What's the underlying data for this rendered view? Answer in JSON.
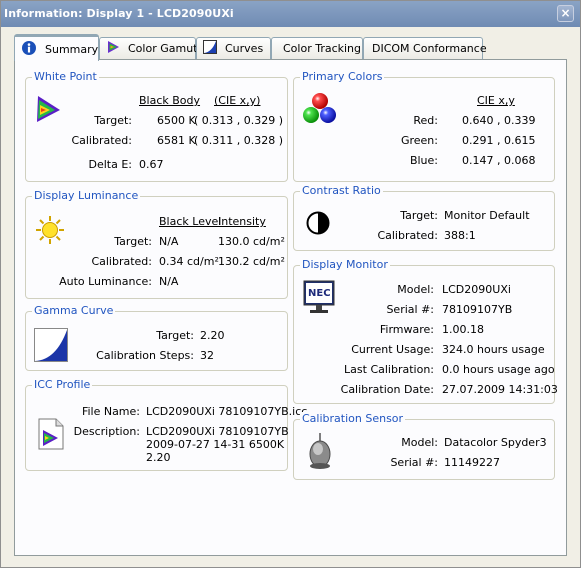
{
  "window": {
    "title": "Information: Display 1 - LCD2090UXi",
    "close_glyph": "×"
  },
  "tabs": [
    {
      "label": "Summary",
      "icon": "info-icon"
    },
    {
      "label": "Color Gamut",
      "icon": "color-gamut-icon"
    },
    {
      "label": "Curves",
      "icon": "curves-icon"
    },
    {
      "label": "Color Tracking"
    },
    {
      "label": "DICOM Conformance"
    }
  ],
  "white_point": {
    "title": "White Point",
    "col1": "Black Body",
    "col2": "(CIE x,y)",
    "target_label": "Target:",
    "target_value": "6500 K",
    "target_xy": "( 0.313 , 0.329 )",
    "calibrated_label": "Calibrated:",
    "calibrated_value": "6581 K",
    "calibrated_xy": "( 0.311 , 0.328 )",
    "delta_label": "Delta E:",
    "delta_value": "0.67"
  },
  "luminance": {
    "title": "Display Luminance",
    "col1": "Black Level",
    "col2": "Intensity",
    "target_label": "Target:",
    "target_black": "N/A",
    "target_intensity": "130.0 cd/m²",
    "calibrated_label": "Calibrated:",
    "calibrated_black": "0.34 cd/m²",
    "calibrated_intensity": "130.2 cd/m²",
    "auto_label": "Auto Luminance:",
    "auto_value": "N/A"
  },
  "gamma": {
    "title": "Gamma Curve",
    "target_label": "Target:",
    "target_value": "2.20",
    "steps_label": "Calibration Steps:",
    "steps_value": "32"
  },
  "icc": {
    "title": "ICC Profile",
    "file_label": "File Name:",
    "file_value": "LCD2090UXi 78109107YB.icc",
    "desc_label": "Description:",
    "desc_line1": "LCD2090UXi 78109107YB",
    "desc_line2": "2009-07-27 14-31 6500K",
    "desc_line3": "2.20"
  },
  "primaries": {
    "title": "Primary Colors",
    "col": "CIE x,y",
    "red_label": "Red:",
    "red_value": "0.640 , 0.339",
    "green_label": "Green:",
    "green_value": "0.291 , 0.615",
    "blue_label": "Blue:",
    "blue_value": "0.147 , 0.068",
    "colors": {
      "red": "#e8161b",
      "green": "#1ec41e",
      "blue": "#1c2fd6"
    }
  },
  "contrast": {
    "title": "Contrast Ratio",
    "target_label": "Target:",
    "target_value": "Monitor Default",
    "calibrated_label": "Calibrated:",
    "calibrated_value": "388:1"
  },
  "monitor": {
    "title": "Display Monitor",
    "logo_text": "NEC",
    "model_label": "Model:",
    "model_value": "LCD2090UXi",
    "serial_label": "Serial #:",
    "serial_value": "78109107YB",
    "firmware_label": "Firmware:",
    "firmware_value": "1.00.18",
    "usage_label": "Current Usage:",
    "usage_value": "324.0 hours usage",
    "last_label": "Last Calibration:",
    "last_value": "0.0 hours usage ago",
    "date_label": "Calibration Date:",
    "date_value": "27.07.2009 14:31:03"
  },
  "sensor": {
    "title": "Calibration Sensor",
    "model_label": "Model:",
    "model_value": "Datacolor Spyder3",
    "serial_label": "Serial #:",
    "serial_value": "11149227"
  },
  "accent": {
    "legend": "#2155c0",
    "active_tab": "#ffc83c"
  }
}
